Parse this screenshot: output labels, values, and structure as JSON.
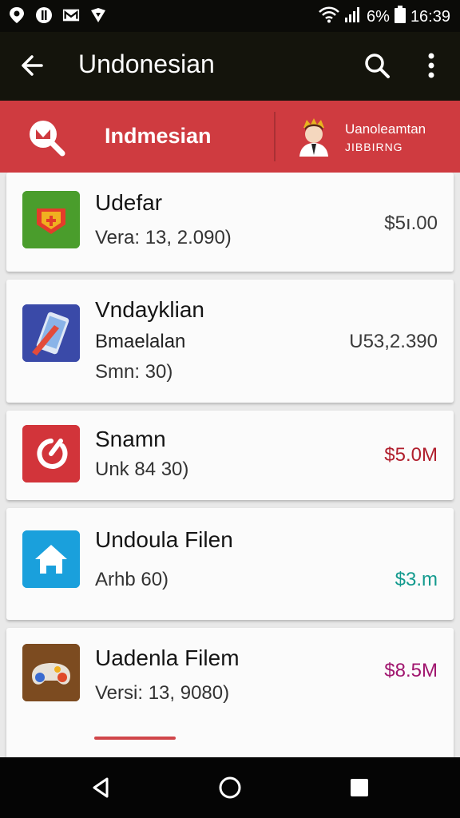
{
  "status_bar": {
    "left_icons": [
      "location-icon",
      "notification-icon",
      "gmail-icon",
      "shield-icon"
    ],
    "battery_text": "6%",
    "time": "16:39"
  },
  "app_bar": {
    "title": "Undonesian"
  },
  "red_bar": {
    "language": "Indmesian",
    "account_name": "Uanoleamtan",
    "account_sub": "JIBBIRNG"
  },
  "items": [
    {
      "title": "Udefar",
      "lines": [
        "Vera: 13, 2.090)"
      ],
      "price": "$5ı.00",
      "price_color": "#3a3a3a",
      "icon": "shield-game-icon"
    },
    {
      "title": "Vndayklian",
      "lines": [
        "Bmaelalan",
        "Smn: 30)"
      ],
      "price": "U53,2.390",
      "price_color": "#3a3a3a",
      "icon": "phone-pencil-icon"
    },
    {
      "title": "Snamn",
      "lines": [
        "Unk 84 30)"
      ],
      "price": "$5.0M",
      "price_color": "#b01e2c",
      "icon": "red-spinner-icon"
    },
    {
      "title": "Undoula Filen",
      "lines": [
        "Arhb 60)"
      ],
      "price": "$3.m",
      "price_color": "#139a8e",
      "icon": "home-icon"
    },
    {
      "title": "Uadenla Filem",
      "lines": [
        "Versi: 13, 9080)"
      ],
      "price": "$8.5M",
      "price_color": "#a0156e",
      "icon": "game-controller-icon"
    }
  ],
  "colors": {
    "accent_red": "#cf3b40",
    "status_bar": "#0b0b08",
    "app_bar": "#14140c"
  }
}
